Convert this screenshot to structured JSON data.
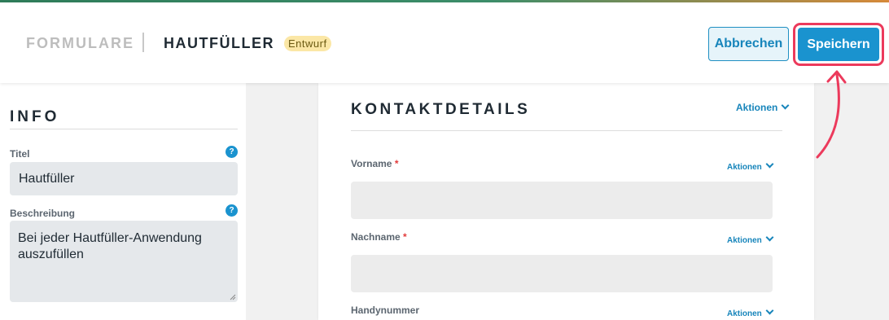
{
  "header": {
    "breadcrumb_root": "FORMULARE",
    "title": "HAUTFÜLLER",
    "status_badge": "Entwurf",
    "cancel_label": "Abbrechen",
    "save_label": "Speichern"
  },
  "sidebar": {
    "heading": "INFO",
    "fields": [
      {
        "label": "Titel",
        "value": "Hautfüller",
        "help": "?"
      },
      {
        "label": "Beschreibung",
        "value": "Bei jeder Hautfüller-Anwendung auszufüllen",
        "help": "?"
      }
    ]
  },
  "main": {
    "section_title": "KONTAKTDETAILS",
    "section_actions": "Aktionen",
    "fields": [
      {
        "label": "Vorname",
        "required": "*",
        "actions": "Aktionen",
        "value": ""
      },
      {
        "label": "Nachname",
        "required": "*",
        "actions": "Aktionen",
        "value": ""
      },
      {
        "label": "Handynummer",
        "required": "",
        "actions": "Aktionen",
        "value": ""
      }
    ]
  },
  "colors": {
    "accent": "#1a93cf",
    "highlight": "#ec3a5c",
    "badge": "#fbe7a6"
  },
  "icons": [
    "help-icon",
    "chevron-down-icon",
    "annotation-arrow",
    "resize-grip-icon"
  ]
}
